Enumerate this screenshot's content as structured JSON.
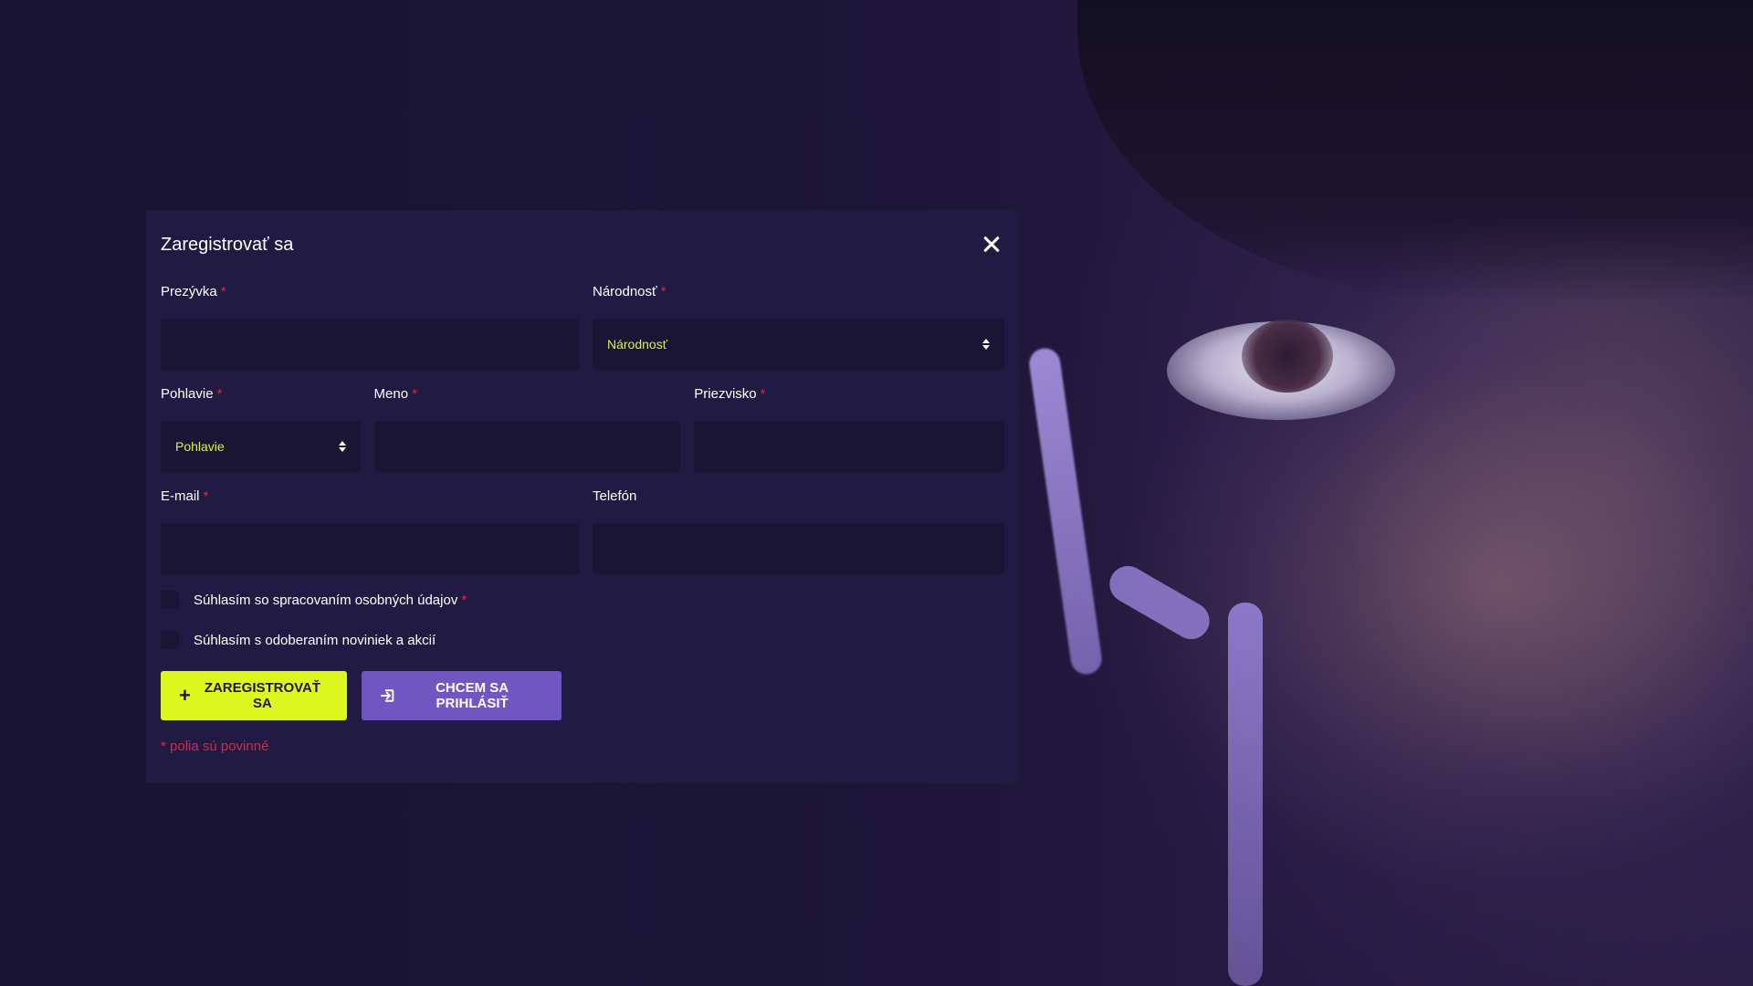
{
  "modal": {
    "title": "Zaregistrovať sa",
    "required_mark": "*"
  },
  "fields": {
    "nickname": {
      "label": "Prezývka",
      "value": "",
      "required": true
    },
    "nationality": {
      "label": "Národnosť",
      "selected": "Národnosť",
      "required": true
    },
    "gender": {
      "label": "Pohlavie",
      "selected": "Pohlavie",
      "required": true
    },
    "first_name": {
      "label": "Meno",
      "value": "",
      "required": true
    },
    "last_name": {
      "label": "Priezvisko",
      "value": "",
      "required": true
    },
    "email": {
      "label": "E-mail",
      "value": "",
      "required": true
    },
    "phone": {
      "label": "Telefón",
      "value": "",
      "required": false
    }
  },
  "checkboxes": {
    "privacy": {
      "label": "Súhlasím so spracovaním osobných údajov",
      "checked": false,
      "required": true
    },
    "newsletter": {
      "label": "Súhlasím s odoberaním noviniek a akcií",
      "checked": false,
      "required": false
    }
  },
  "buttons": {
    "register": "ZAREGISTROVAŤ SA",
    "login": "CHCEM SA PRIHLÁSIŤ"
  },
  "footer_note": "* polia sú povinné",
  "colors": {
    "background": "#191433",
    "modal": "#211b44",
    "input": "#1a1535",
    "accent_yellow": "#dcf71d",
    "accent_purple": "#6f56c0",
    "required_red": "#d6284a"
  },
  "icons": {
    "close": "close-icon",
    "select_arrows": "sort-icon",
    "register": "plus-icon",
    "login": "sign-in-icon"
  }
}
